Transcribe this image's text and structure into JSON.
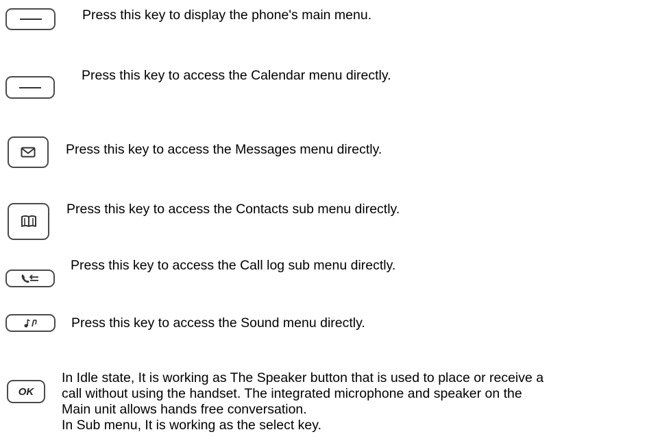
{
  "keys": [
    {
      "icon": "dash-icon",
      "text": "Press this key to display the phone's main menu."
    },
    {
      "icon": "dash-icon",
      "text": "Press this key to access the Calendar menu directly."
    },
    {
      "icon": "envelope-icon",
      "text": "Press this key to access the Messages menu directly."
    },
    {
      "icon": "book-icon",
      "text": "Press this key to access the Contacts sub menu directly."
    },
    {
      "icon": "call-log-icon",
      "text": "Press this key to access the Call log sub menu directly."
    },
    {
      "icon": "music-note-icon",
      "text": "Press this key to access the Sound menu directly."
    },
    {
      "icon": "ok-icon",
      "label": "OK",
      "lines": [
        "In Idle state, It is working as The Speaker button that is used to place or receive a",
        "call without using the handset. The integrated microphone and speaker on the",
        "Main unit allows hands free conversation.",
        "In Sub menu, It is working as the select key."
      ]
    }
  ]
}
